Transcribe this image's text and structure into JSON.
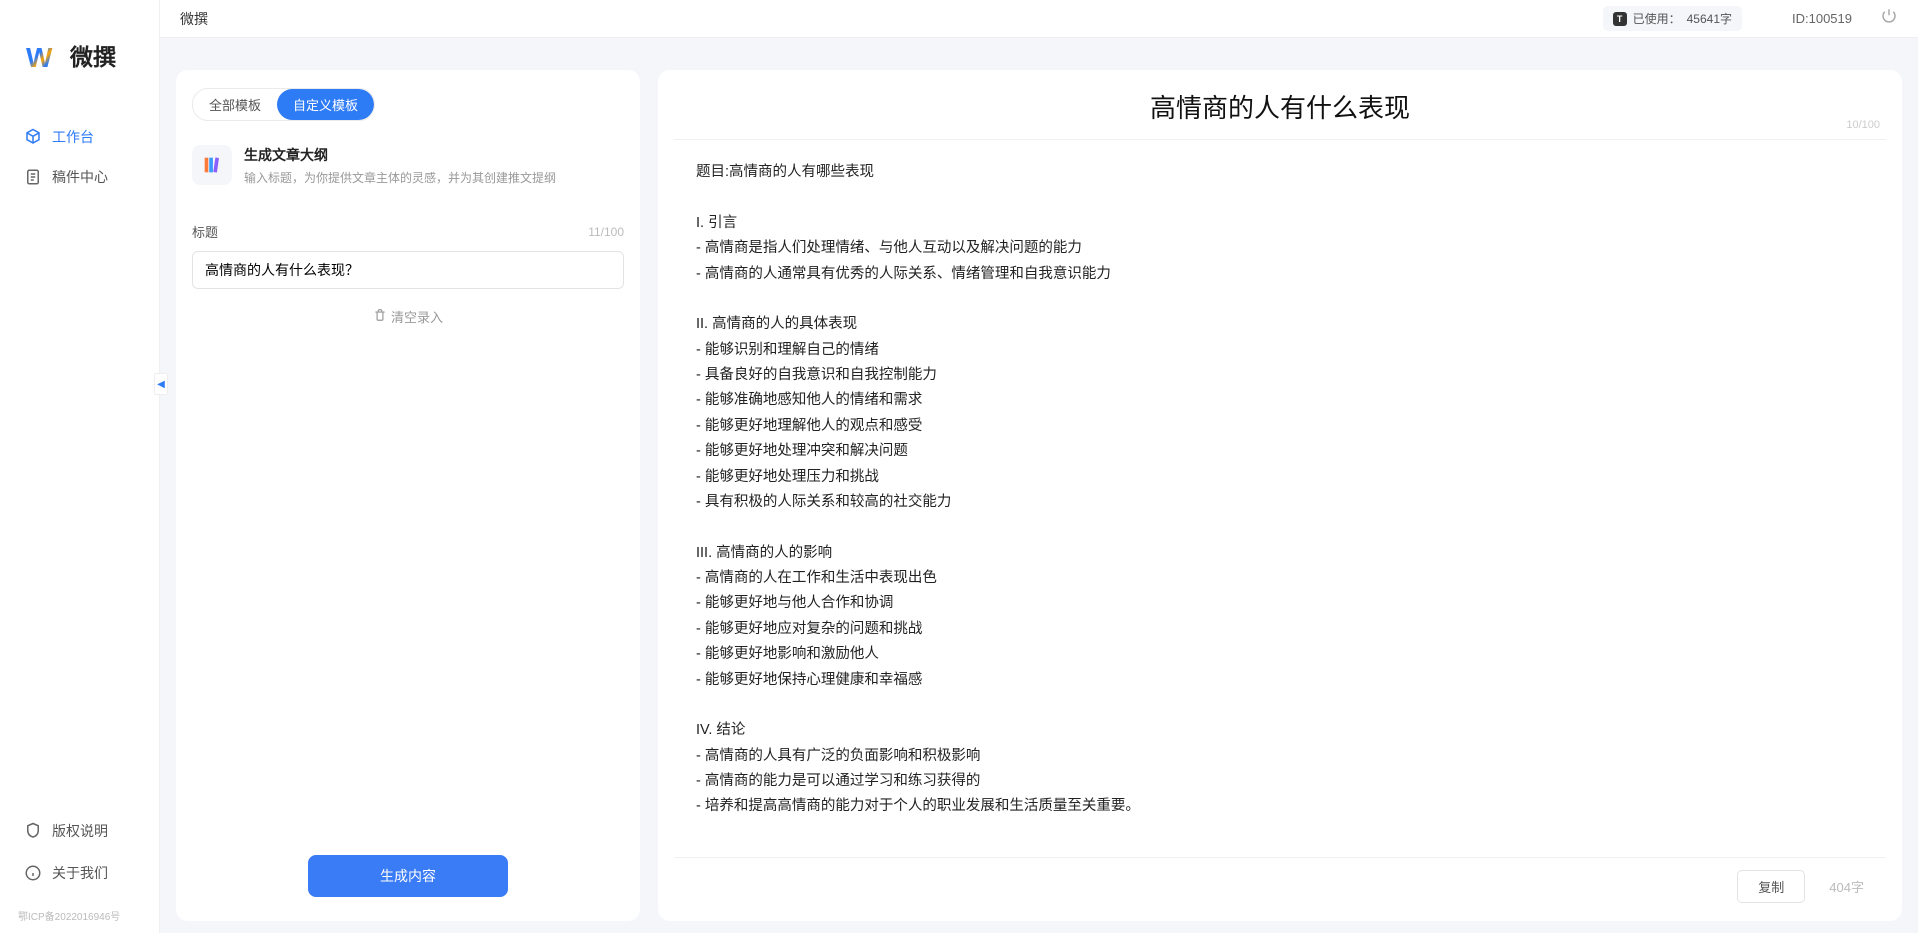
{
  "brand": {
    "name": "微撰"
  },
  "topbar": {
    "title": "微撰",
    "used_label": "已使用：",
    "used_value": "45641字",
    "id_label": "ID:100519"
  },
  "sidebar": {
    "nav": [
      {
        "label": "工作台",
        "icon": "cube-icon",
        "active": true
      },
      {
        "label": "稿件中心",
        "icon": "doc-icon",
        "active": false
      }
    ],
    "footer": [
      {
        "label": "版权说明",
        "icon": "shield-icon"
      },
      {
        "label": "关于我们",
        "icon": "info-icon"
      }
    ],
    "copyright": "鄂ICP备2022016946号"
  },
  "left": {
    "tabs": [
      {
        "label": "全部模板",
        "active": false
      },
      {
        "label": "自定义模板",
        "active": true
      }
    ],
    "template": {
      "title": "生成文章大纲",
      "desc": "输入标题，为你提供文章主体的灵感，并为其创建推文提纲"
    },
    "field_label": "标题",
    "field_count": "11/100",
    "title_value": "高情商的人有什么表现？",
    "clear_label": "清空录入",
    "generate_label": "生成内容"
  },
  "doc": {
    "title": "高情商的人有什么表现",
    "limit": "10/100",
    "body": "题目:高情商的人有哪些表现\n\nI. 引言\n- 高情商是指人们处理情绪、与他人互动以及解决问题的能力\n- 高情商的人通常具有优秀的人际关系、情绪管理和自我意识能力\n\nII. 高情商的人的具体表现\n- 能够识别和理解自己的情绪\n- 具备良好的自我意识和自我控制能力\n- 能够准确地感知他人的情绪和需求\n- 能够更好地理解他人的观点和感受\n- 能够更好地处理冲突和解决问题\n- 能够更好地处理压力和挑战\n- 具有积极的人际关系和较高的社交能力\n\nIII. 高情商的人的影响\n- 高情商的人在工作和生活中表现出色\n- 能够更好地与他人合作和协调\n- 能够更好地应对复杂的问题和挑战\n- 能够更好地影响和激励他人\n- 能够更好地保持心理健康和幸福感\n\nIV. 结论\n- 高情商的人具有广泛的负面影响和积极影响\n- 高情商的能力是可以通过学习和练习获得的\n- 培养和提高高情商的能力对于个人的职业发展和生活质量至关重要。",
    "copy_label": "复制",
    "count": "404字"
  }
}
